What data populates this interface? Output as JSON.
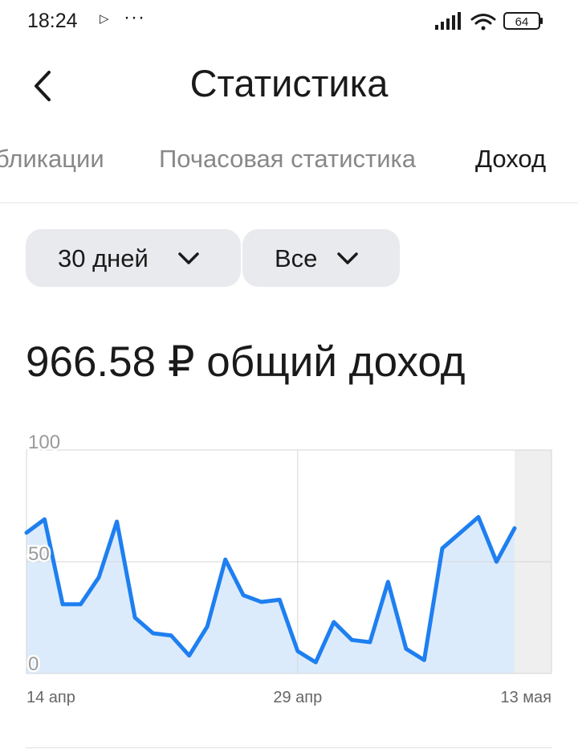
{
  "status_bar": {
    "time": "18:24",
    "play_icon": "play-icon",
    "more": "···",
    "battery": "64",
    "icons": [
      "signal-icon",
      "wifi-icon",
      "battery-icon"
    ]
  },
  "header": {
    "title": "Статистика",
    "back_icon": "chevron-left-icon"
  },
  "tabs": [
    {
      "label": "бликации",
      "active": false
    },
    {
      "label": "Почасовая статистика",
      "active": false
    },
    {
      "label": "Доход",
      "active": true
    }
  ],
  "filters": {
    "period": "30 дней",
    "scope": "Все"
  },
  "summary": {
    "total": "966.58 ₽ общий доход"
  },
  "chart_data": {
    "type": "area",
    "y_ticks": [
      "100",
      "50",
      "0"
    ],
    "ylim": [
      0,
      100
    ],
    "x_tick_labels": [
      "14 апр",
      "29 апр",
      "13 мая"
    ],
    "x_tick_index": [
      1,
      16,
      28
    ],
    "values": [
      63,
      69,
      31,
      31,
      43,
      68,
      25,
      18,
      17,
      8,
      21,
      51,
      35,
      32,
      33,
      10,
      5,
      23,
      15,
      14,
      41,
      11,
      6,
      56,
      63,
      70,
      50,
      65
    ],
    "colors": {
      "line": "#1e7ff0",
      "fill": "#dcebfc",
      "grid": "#d6d6d6",
      "unavailable": "#efefef"
    },
    "grid": true
  }
}
